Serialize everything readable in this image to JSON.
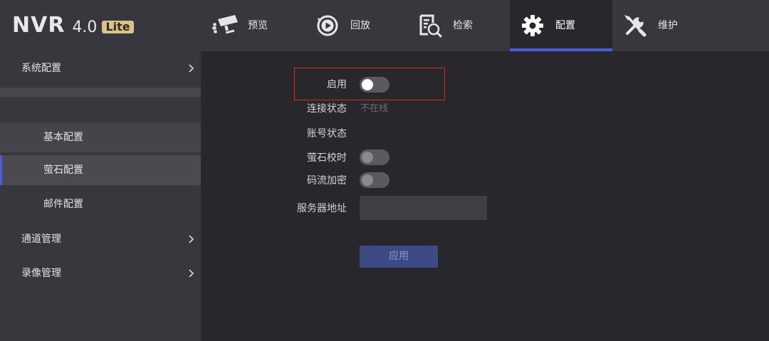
{
  "logo": {
    "brand": "NVR",
    "version": "4.0",
    "edition": "Lite"
  },
  "nav": [
    {
      "label": "预览",
      "icon": "camera-icon"
    },
    {
      "label": "回放",
      "icon": "playback-icon"
    },
    {
      "label": "检索",
      "icon": "search-document-icon"
    },
    {
      "label": "配置",
      "icon": "gear-icon",
      "active": true
    },
    {
      "label": "维护",
      "icon": "wrench-screwdriver-icon"
    }
  ],
  "sidebar": {
    "system_config": "系统配置",
    "sub_items": [
      "基本配置",
      "萤石配置",
      "邮件配置"
    ],
    "active_sub": "萤石配置",
    "channel_mgmt": "通道管理",
    "record_mgmt": "录像管理"
  },
  "form": {
    "enable_label": "启用",
    "enable_on": true,
    "connection_label": "连接状态",
    "connection_value": "不在线",
    "account_label": "账号状态",
    "time_sync_label": "萤石校时",
    "time_sync_on": false,
    "stream_encrypt_label": "码流加密",
    "stream_encrypt_on": false,
    "server_label": "服务器地址",
    "server_value": "",
    "apply_label": "应用"
  },
  "colors": {
    "accent": "#4a5ed8",
    "highlight_box": "#e02424",
    "apply_button": "#3e4a86"
  }
}
